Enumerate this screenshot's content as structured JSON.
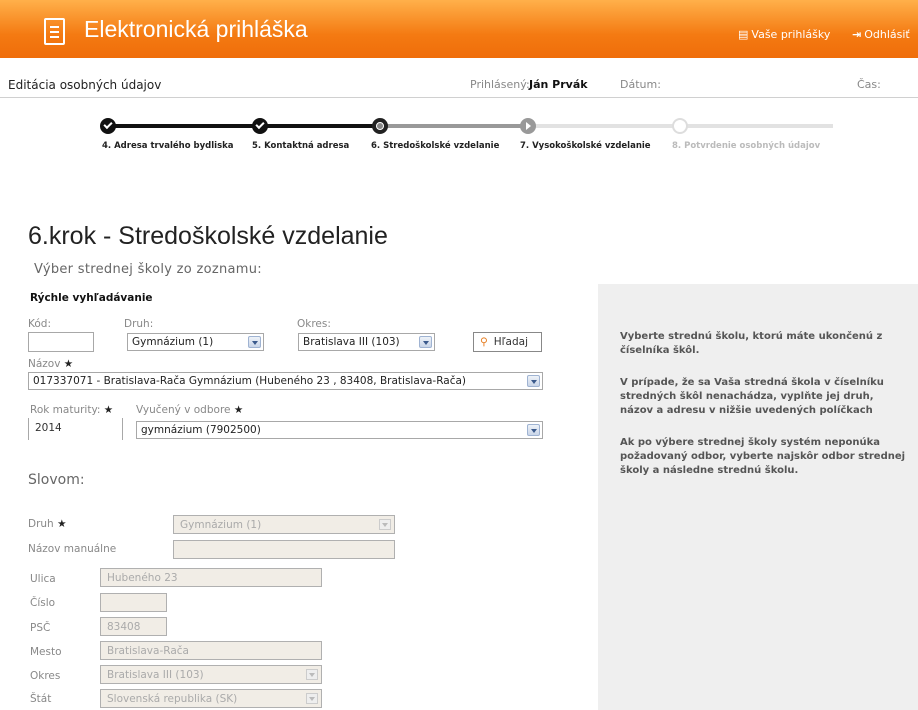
{
  "header": {
    "app_title": "Elektronická prihláška",
    "link_applications": "Vaše prihlášky",
    "link_logout": "Odhlásiť",
    "colors": {
      "accent": "#f47a12"
    }
  },
  "subheader": {
    "title": "Editácia osobných údajov",
    "logged_label": "Prihlásený:",
    "logged_user": "Ján Prvák",
    "date_label": "Dátum:",
    "time_label": "Čas:"
  },
  "stepper": {
    "steps": [
      {
        "label": "4. Adresa trvalého bydliska",
        "state": "done"
      },
      {
        "label": "5. Kontaktná adresa",
        "state": "done"
      },
      {
        "label": "6. Stredoškolské vzdelanie",
        "state": "current"
      },
      {
        "label": "7. Vysokoškolské vzdelanie",
        "state": "next"
      },
      {
        "label": "8. Potvrdenie osobných údajov",
        "state": "future"
      }
    ]
  },
  "main": {
    "title": "6.krok - Stredoškolské vzdelanie",
    "subtitle": "Výber strednej školy zo zoznamu:",
    "quick_search": "Rýchle vyhľadávanie",
    "kod_label": "Kód:",
    "kod_value": "",
    "druh_label": "Druh:",
    "druh_value": "Gymnázium (1)",
    "okres_label": "Okres:",
    "okres_value": "Bratislava III (103)",
    "search_button": "Hľadaj",
    "nazov_label": "Názov",
    "nazov_value": "017337071 - Bratislava-Rača Gymnázium (Hubeného 23 , 83408, Bratislava-Rača)",
    "rok_label": "Rok maturity:",
    "rok_value": "2014",
    "odbor_label": "Vyučený v odbore",
    "odbor_value": "gymnázium (7902500)",
    "slovom": "Slovom:"
  },
  "manual": {
    "druh_label": "Druh",
    "druh_value": "Gymnázium (1)",
    "nazov_label": "Názov manuálne",
    "nazov_value": "",
    "ulica_label": "Ulica",
    "ulica_value": "Hubeného 23",
    "cislo_label": "Číslo",
    "cislo_value": "",
    "psc_label": "PSČ",
    "psc_value": "83408",
    "mesto_label": "Mesto",
    "mesto_value": "Bratislava-Rača",
    "okres_label": "Okres",
    "okres_value": "Bratislava III (103)",
    "stat_label": "Štát",
    "stat_value": "Slovenská republika (SK)"
  },
  "panel": {
    "p1": "Vyberte strednú školu, ktorú máte ukončenú z číselníka škôl.",
    "p2": "V prípade, že sa Vaša stredná škola v číselníku stredných škôl nenachádza, vyplňte jej druh, názov a adresu v nižšie uvedených políčkach",
    "p3": "Ak po výbere strednej školy systém neponúka požadovaný odbor, vyberte najskôr odbor strednej školy a následne strednú školu."
  }
}
